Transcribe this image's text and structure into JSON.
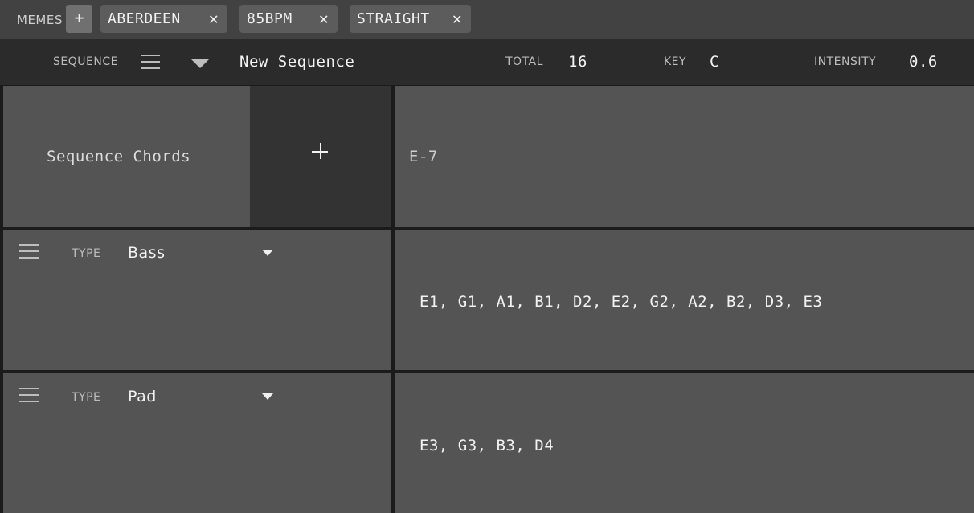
{
  "memes": {
    "label": "MEMES",
    "add_icon": "plus-icon",
    "chips": [
      {
        "label": "ABERDEEN",
        "remove_icon": "close-icon"
      },
      {
        "label": "85BPM",
        "remove_icon": "close-icon"
      },
      {
        "label": "STRAIGHT",
        "remove_icon": "close-icon"
      }
    ]
  },
  "header": {
    "sequence_label": "SEQUENCE",
    "sequence_name": "New Sequence",
    "total_label": "TOTAL",
    "total_value": "16",
    "key_label": "KEY",
    "key_value": "C",
    "intensity_label": "INTENSITY",
    "intensity_value": "0.6"
  },
  "chords": {
    "label": "Sequence Chords",
    "chord": "E-7"
  },
  "voices": [
    {
      "type_label": "TYPE",
      "type_value": "Bass",
      "notes": "E1, G1, A1, B1, D2, E2, G2, A2, B2, D3, E3"
    },
    {
      "type_label": "TYPE",
      "type_value": "Pad",
      "notes": "E3, G3, B3, D4"
    }
  ],
  "icons": {
    "plus": "+",
    "close": "✕"
  },
  "colors": {
    "background": "#1b1b1b",
    "panel": "#545454",
    "chip": "#5c5c5c",
    "header": "#2b2b2b"
  }
}
